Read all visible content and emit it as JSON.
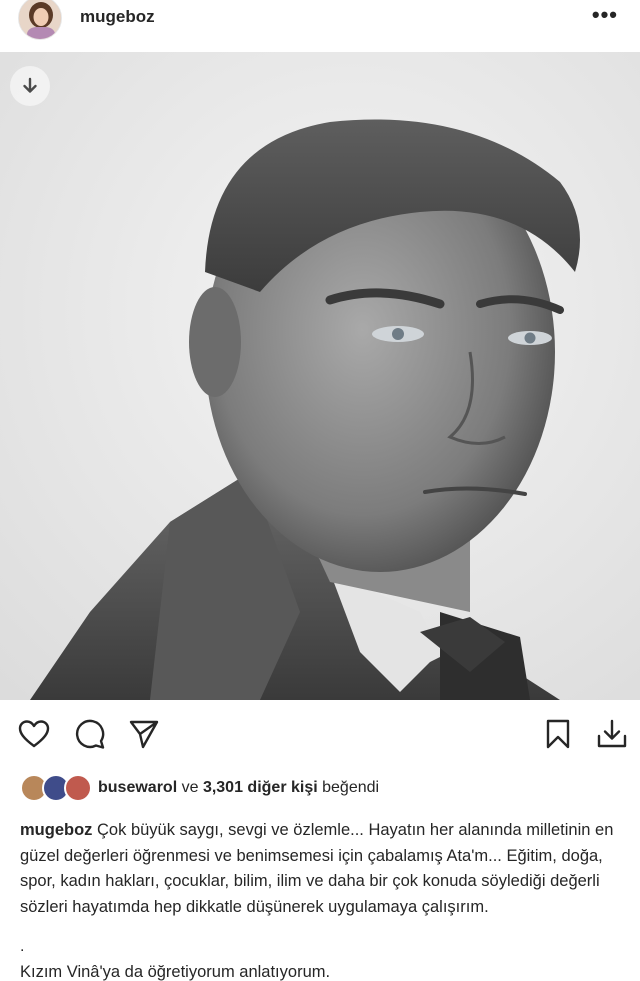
{
  "post": {
    "username": "mugeboz",
    "more_label": "•••"
  },
  "likes": {
    "user": "busewarol",
    "connector": " ve ",
    "others": "3,301 diğer kişi",
    "suffix": " beğendi"
  },
  "caption": {
    "username": "mugeboz",
    "text": "Çok büyük saygı, sevgi ve özlemle... Hayatın her alanında milletinin en güzel değerleri öğrenmesi ve benimsemesi için çabalamış Ata'm... Eğitim, doğa, spor, kadın hakları, çocuklar, bilim, ilim ve daha bir çok konuda söylediği değerli sözleri hayatımda hep dikkatle düşünerek uygulamaya çalışırım.",
    "dot": ".",
    "second_line": "Kızım Vinâ'ya da öğretiyorum anlatıyorum."
  },
  "icons": {
    "more": "more-options-icon",
    "download_badge": "download-icon",
    "like": "heart-icon",
    "comment": "comment-icon",
    "share": "send-icon",
    "save": "bookmark-icon",
    "download": "download-icon"
  }
}
